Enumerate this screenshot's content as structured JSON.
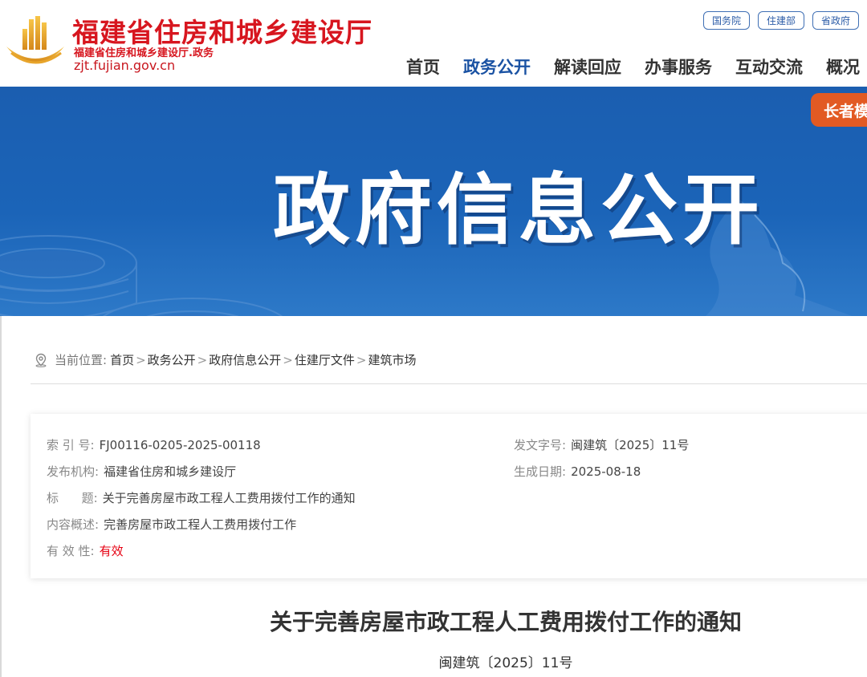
{
  "header": {
    "title": "福建省住房和城乡建设厅",
    "subtitle": "福建省住房和城乡建设厅.政务",
    "domain": "zjt.fujian.gov.cn",
    "toplinks": [
      "国务院",
      "住建部",
      "省政府"
    ],
    "nav": [
      "首页",
      "政务公开",
      "解读回应",
      "办事服务",
      "互动交流",
      "概况"
    ],
    "active_nav": "政务公开"
  },
  "banner": {
    "title": "政府信息公开",
    "elder_mode": "长者模式"
  },
  "breadcrumb": {
    "label": "当前位置:",
    "items": [
      "首页",
      "政务公开",
      "政府信息公开",
      "住建厅文件",
      "建筑市场"
    ],
    "separator": ">"
  },
  "meta": {
    "index_no_label": "索 引 号:",
    "index_no": "FJ00116-0205-2025-00118",
    "doc_no_label": "发文字号:",
    "doc_no": "闽建筑〔2025〕11号",
    "publisher_label": "发布机构:",
    "publisher": "福建省住房和城乡建设厅",
    "date_label": "生成日期:",
    "date": "2025-08-18",
    "title_label": "标      题:",
    "title": "关于完善房屋市政工程人工费用拨付工作的通知",
    "summary_label": "内容概述:",
    "summary": "完善房屋市政工程人工费用拨付工作",
    "validity_label": "有 效 性:",
    "validity": "有效",
    "validity_color": "#e60012"
  },
  "document": {
    "title": "关于完善房屋市政工程人工费用拨付工作的通知",
    "number": "闽建筑〔2025〕11号"
  },
  "colors": {
    "brand_red": "#d7161f",
    "nav_active": "#1a52a3",
    "banner_blue": "#1b5eb0",
    "elder_orange": "#e25a23"
  }
}
